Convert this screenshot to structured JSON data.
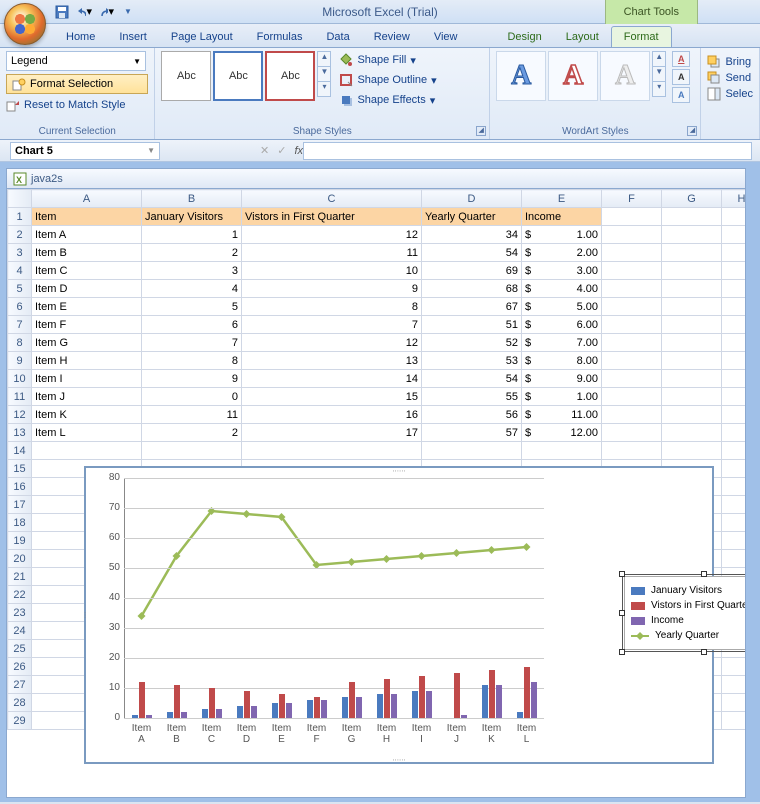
{
  "app_title": "Microsoft Excel (Trial)",
  "chart_tools": "Chart Tools",
  "tabs": [
    "Home",
    "Insert",
    "Page Layout",
    "Formulas",
    "Data",
    "Review",
    "View"
  ],
  "ctabs": [
    "Design",
    "Layout",
    "Format"
  ],
  "active_tab": "Format",
  "selection": {
    "combo": "Legend",
    "format_sel": "Format Selection",
    "reset": "Reset to Match Style",
    "group": "Current Selection"
  },
  "shape_styles": {
    "label": "Abc",
    "fill": "Shape Fill",
    "outline": "Shape Outline",
    "effects": "Shape Effects",
    "group": "Shape Styles"
  },
  "wordart": {
    "group": "WordArt Styles"
  },
  "arrange": {
    "bring": "Bring",
    "send": "Send",
    "select": "Selec"
  },
  "namebox": "Chart 5",
  "mdi_title": "java2s",
  "cols": [
    "A",
    "B",
    "C",
    "D",
    "E",
    "F",
    "G",
    "H"
  ],
  "headers": [
    "Item",
    "January Visitors",
    "Vistors in First Quarter",
    "Yearly Quarter",
    "Income"
  ],
  "currency": "$",
  "rows": [
    {
      "item": "Item A",
      "jan": 1,
      "vis": 12,
      "yq": 34,
      "inc": "1.00"
    },
    {
      "item": "Item B",
      "jan": 2,
      "vis": 11,
      "yq": 54,
      "inc": "2.00"
    },
    {
      "item": "Item C",
      "jan": 3,
      "vis": 10,
      "yq": 69,
      "inc": "3.00"
    },
    {
      "item": "Item D",
      "jan": 4,
      "vis": 9,
      "yq": 68,
      "inc": "4.00"
    },
    {
      "item": "Item E",
      "jan": 5,
      "vis": 8,
      "yq": 67,
      "inc": "5.00"
    },
    {
      "item": "Item F",
      "jan": 6,
      "vis": 7,
      "yq": 51,
      "inc": "6.00"
    },
    {
      "item": "Item G",
      "jan": 7,
      "vis": 12,
      "yq": 52,
      "inc": "7.00"
    },
    {
      "item": "Item H",
      "jan": 8,
      "vis": 13,
      "yq": 53,
      "inc": "8.00"
    },
    {
      "item": "Item I",
      "jan": 9,
      "vis": 14,
      "yq": 54,
      "inc": "9.00"
    },
    {
      "item": "Item J",
      "jan": 0,
      "vis": 15,
      "yq": 55,
      "inc": "1.00"
    },
    {
      "item": "Item K",
      "jan": 11,
      "vis": 16,
      "yq": 56,
      "inc": "11.00"
    },
    {
      "item": "Item L",
      "jan": 2,
      "vis": 17,
      "yq": 57,
      "inc": "12.00"
    }
  ],
  "chart_data": {
    "type": "combo",
    "categories": [
      "Item A",
      "Item B",
      "Item C",
      "Item D",
      "Item E",
      "Item F",
      "Item G",
      "Item H",
      "Item I",
      "Item J",
      "Item K",
      "Item L"
    ],
    "series": [
      {
        "name": "January Visitors",
        "type": "bar",
        "color": "#4a7abf",
        "values": [
          1,
          2,
          3,
          4,
          5,
          6,
          7,
          8,
          9,
          0,
          11,
          2
        ]
      },
      {
        "name": "Vistors in First Quarter",
        "type": "bar",
        "color": "#c04a4a",
        "values": [
          12,
          11,
          10,
          9,
          8,
          7,
          12,
          13,
          14,
          15,
          16,
          17
        ]
      },
      {
        "name": "Income",
        "type": "bar",
        "color": "#8066b0",
        "values": [
          1,
          2,
          3,
          4,
          5,
          6,
          7,
          8,
          9,
          1,
          11,
          12
        ]
      },
      {
        "name": "Yearly Quarter",
        "type": "line",
        "color": "#9cbb58",
        "values": [
          34,
          54,
          69,
          68,
          67,
          51,
          52,
          53,
          54,
          55,
          56,
          57
        ]
      }
    ],
    "ylim": [
      0,
      80
    ],
    "yticks": [
      0,
      10,
      20,
      30,
      40,
      50,
      60,
      70,
      80
    ],
    "legend_position": "right"
  }
}
